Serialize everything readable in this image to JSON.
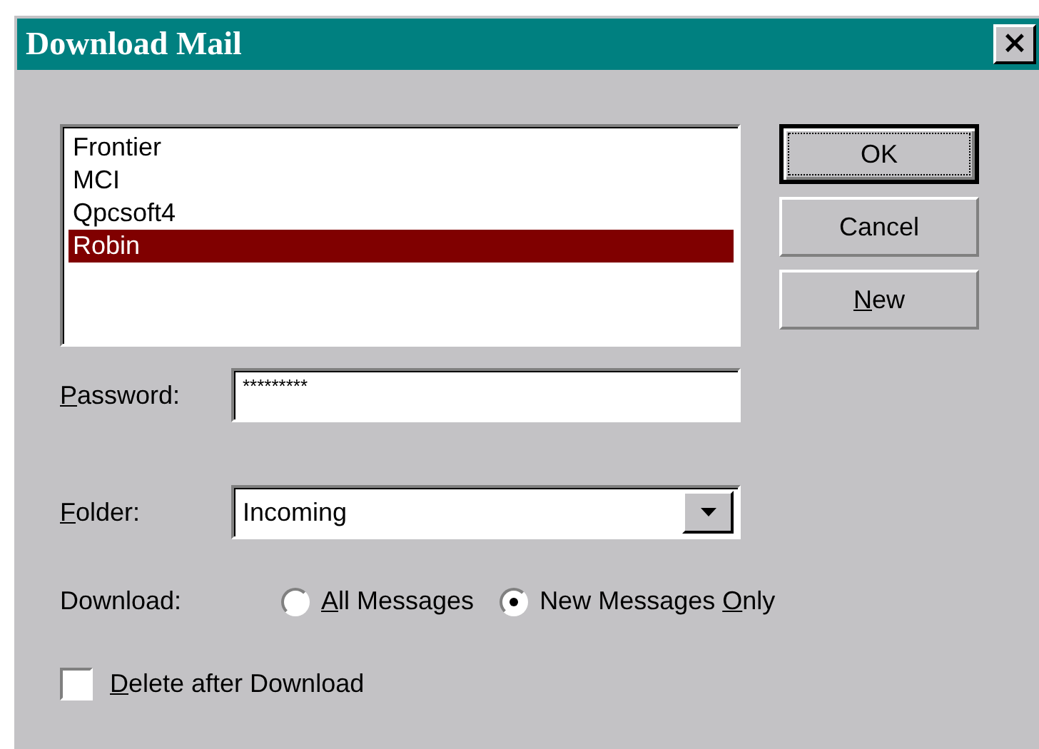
{
  "window": {
    "title": "Download Mail",
    "close": "×"
  },
  "accounts": [
    {
      "label": "Frontier",
      "selected": false
    },
    {
      "label": "MCI",
      "selected": false
    },
    {
      "label": "Qpcsoft4",
      "selected": false
    },
    {
      "label": "Robin",
      "selected": true
    }
  ],
  "buttons": [
    {
      "label": [
        {
          "text": "OK"
        }
      ],
      "default": true
    },
    {
      "label": [
        {
          "text": "Cancel"
        }
      ],
      "default": false
    },
    {
      "label": [
        {
          "key": "N"
        },
        {
          "text": "ew"
        }
      ],
      "default": false
    }
  ],
  "password": {
    "label": [
      {
        "key": "P"
      },
      {
        "text": "assword:"
      }
    ],
    "value": "*********"
  },
  "folder": {
    "label": [
      {
        "key": "F"
      },
      {
        "text": "older:"
      }
    ],
    "value": "Incoming"
  },
  "download": {
    "label": [
      {
        "text": "Download:"
      }
    ],
    "options": [
      {
        "label": [
          {
            "key": "A"
          },
          {
            "text": "ll Messages"
          }
        ],
        "selected": false
      },
      {
        "label": [
          {
            "text": "New Messages "
          },
          {
            "key": "O"
          },
          {
            "text": "nly"
          }
        ],
        "selected": true
      }
    ]
  },
  "delete_after": {
    "label": [
      {
        "key": "D"
      },
      {
        "text": "elete after Download"
      }
    ],
    "checked": false
  }
}
